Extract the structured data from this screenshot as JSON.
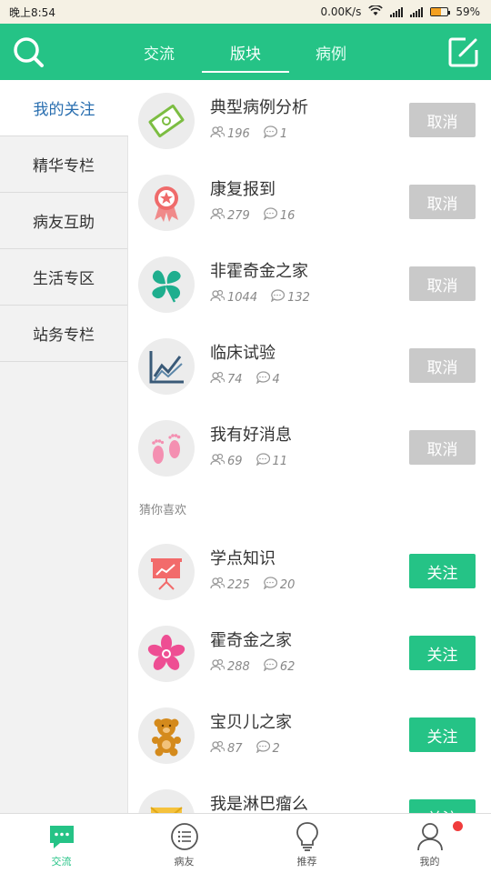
{
  "status_bar": {
    "time": "晚上8:54",
    "speed": "0.00K/s",
    "battery": "59%",
    "battery_level": 0.59
  },
  "header": {
    "tabs": [
      {
        "label": "交流"
      },
      {
        "label": "版块"
      },
      {
        "label": "病例"
      }
    ],
    "active_tab": "版块"
  },
  "sidebar": {
    "items": [
      {
        "label": "我的关注"
      },
      {
        "label": "精华专栏"
      },
      {
        "label": "病友互助"
      },
      {
        "label": "生活专区"
      },
      {
        "label": "站务专栏"
      }
    ],
    "active": "我的关注"
  },
  "followed": [
    {
      "title": "典型病例分析",
      "members": "196",
      "posts": "1",
      "action": "取消",
      "icon": "case-book-icon"
    },
    {
      "title": "康复报到",
      "members": "279",
      "posts": "16",
      "action": "取消",
      "icon": "ribbon-badge-icon"
    },
    {
      "title": "非霍奇金之家",
      "members": "1044",
      "posts": "132",
      "action": "取消",
      "icon": "clover-icon"
    },
    {
      "title": "临床试验",
      "members": "74",
      "posts": "4",
      "action": "取消",
      "icon": "line-chart-icon"
    },
    {
      "title": "我有好消息",
      "members": "69",
      "posts": "11",
      "action": "取消",
      "icon": "footprints-icon"
    }
  ],
  "suggest_label": "猜你喜欢",
  "suggested": [
    {
      "title": "学点知识",
      "members": "225",
      "posts": "20",
      "action": "关注",
      "icon": "presentation-board-icon"
    },
    {
      "title": "霍奇金之家",
      "members": "288",
      "posts": "62",
      "action": "关注",
      "icon": "flower-icon"
    },
    {
      "title": "宝贝儿之家",
      "members": "87",
      "posts": "2",
      "action": "关注",
      "icon": "teddy-bear-icon"
    },
    {
      "title": "我是淋巴瘤么",
      "members": "",
      "posts": "",
      "action": "关注",
      "icon": "envelope-icon"
    }
  ],
  "bottom_nav": [
    {
      "label": "交流"
    },
    {
      "label": "病友"
    },
    {
      "label": "推荐"
    },
    {
      "label": "我的"
    }
  ],
  "colors": {
    "brand_green": "#25c386",
    "cancel_gray": "#c9c9c9",
    "sidebar_active_text": "#2a6fb0",
    "badge_red": "#f03c3c"
  }
}
